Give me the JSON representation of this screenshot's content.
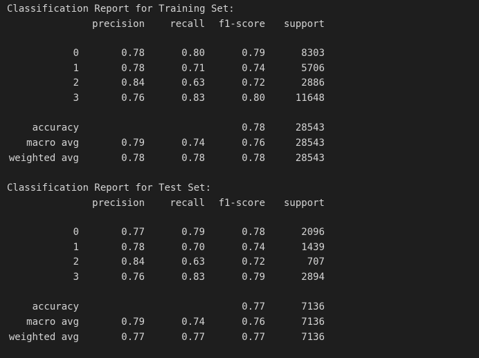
{
  "theme": {
    "background": "#1e1e1e",
    "text": "#d4d4d4"
  },
  "reports": [
    {
      "title": "Classification Report for Training Set:",
      "headers": [
        "precision",
        "recall",
        "f1-score",
        "support"
      ],
      "rows": [
        {
          "label": "0",
          "precision": "0.78",
          "recall": "0.80",
          "f1": "0.79",
          "support": "8303"
        },
        {
          "label": "1",
          "precision": "0.78",
          "recall": "0.71",
          "f1": "0.74",
          "support": "5706"
        },
        {
          "label": "2",
          "precision": "0.84",
          "recall": "0.63",
          "f1": "0.72",
          "support": "2886"
        },
        {
          "label": "3",
          "precision": "0.76",
          "recall": "0.83",
          "f1": "0.80",
          "support": "11648"
        }
      ],
      "summary": [
        {
          "label": "accuracy",
          "precision": "",
          "recall": "",
          "f1": "0.78",
          "support": "28543"
        },
        {
          "label": "macro avg",
          "precision": "0.79",
          "recall": "0.74",
          "f1": "0.76",
          "support": "28543"
        },
        {
          "label": "weighted avg",
          "precision": "0.78",
          "recall": "0.78",
          "f1": "0.78",
          "support": "28543"
        }
      ]
    },
    {
      "title": "Classification Report for Test Set:",
      "headers": [
        "precision",
        "recall",
        "f1-score",
        "support"
      ],
      "rows": [
        {
          "label": "0",
          "precision": "0.77",
          "recall": "0.79",
          "f1": "0.78",
          "support": "2096"
        },
        {
          "label": "1",
          "precision": "0.78",
          "recall": "0.70",
          "f1": "0.74",
          "support": "1439"
        },
        {
          "label": "2",
          "precision": "0.84",
          "recall": "0.63",
          "f1": "0.72",
          "support": "707"
        },
        {
          "label": "3",
          "precision": "0.76",
          "recall": "0.83",
          "f1": "0.79",
          "support": "2894"
        }
      ],
      "summary": [
        {
          "label": "accuracy",
          "precision": "",
          "recall": "",
          "f1": "0.77",
          "support": "7136"
        },
        {
          "label": "macro avg",
          "precision": "0.79",
          "recall": "0.74",
          "f1": "0.76",
          "support": "7136"
        },
        {
          "label": "weighted avg",
          "precision": "0.77",
          "recall": "0.77",
          "f1": "0.77",
          "support": "7136"
        }
      ]
    }
  ]
}
